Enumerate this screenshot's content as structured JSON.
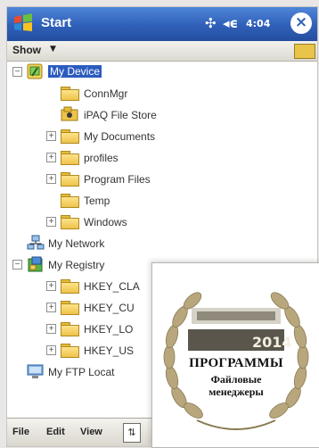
{
  "titlebar": {
    "title": "Start",
    "clock": "4:04",
    "signal_icon": "✣",
    "volume_icon": "◂ϵ",
    "close_label": "×"
  },
  "showbar": {
    "label": "Show",
    "arrow": "▼"
  },
  "tree": {
    "root": "My Device",
    "device_children": [
      "ConnMgr",
      "iPAQ File Store",
      "My Documents",
      "profiles",
      "Program Files",
      "Temp",
      "Windows"
    ],
    "network": "My Network",
    "registry": "My Registry",
    "registry_children": [
      "HKEY_CLA",
      "HKEY_CU",
      "HKEY_LO",
      "HKEY_US"
    ],
    "ftp": "My FTP Locat"
  },
  "menubar": {
    "file": "File",
    "edit": "Edit",
    "view": "View",
    "sort": "⇅"
  },
  "award": {
    "year": "2014",
    "headline": "ПРОГРАММЫ",
    "sub1": "Файловые",
    "sub2": "менеджеры"
  },
  "colors": {
    "title_bar": "#2f5fb8",
    "selection": "#2b5bbf",
    "folder": "#efc24a"
  }
}
